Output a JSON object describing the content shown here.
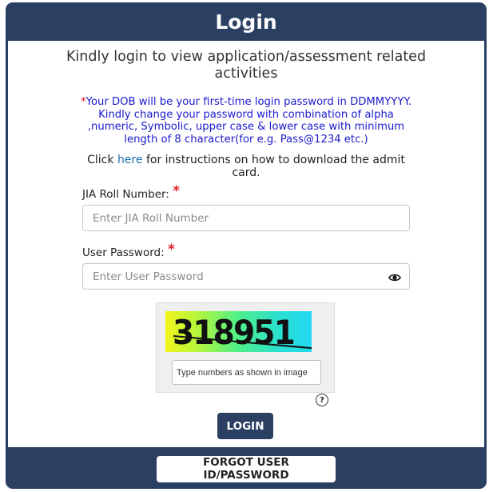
{
  "header": {
    "title": "Login"
  },
  "intro": "Kindly login to view application/assessment related activities",
  "notice": {
    "star": "*",
    "text": "Your DOB will be your first-time login password in DDMMYYYY. Kindly change your password with combination of alpha ,numeric, Symbolic, upper case & lower case with minimum length of 8 character(for e.g. Pass@1234 etc.)"
  },
  "instructions": {
    "prefix": "Click ",
    "link": "here",
    "suffix": " for instructions on how to download the admit card."
  },
  "roll_field": {
    "label": "JIA Roll Number:",
    "required_mark": "*",
    "placeholder": "Enter JIA Roll Number",
    "value": ""
  },
  "password_field": {
    "label": "User Password:",
    "required_mark": "*",
    "placeholder": "Enter User Password",
    "value": "",
    "toggle_icon": "eye-icon"
  },
  "captcha": {
    "code": "318951",
    "refresh_icon": "refresh-icon",
    "input_placeholder": "Type numbers as shown in image",
    "help_icon": "question-circle-icon",
    "help_glyph": "?"
  },
  "buttons": {
    "login": "LOGIN",
    "forgot": "FORGOT USER ID/PASSWORD"
  },
  "colors": {
    "primary": "#2b3f63",
    "notice_text": "#1a1acc",
    "required": "#d8232a",
    "link": "#1a6fa8"
  }
}
